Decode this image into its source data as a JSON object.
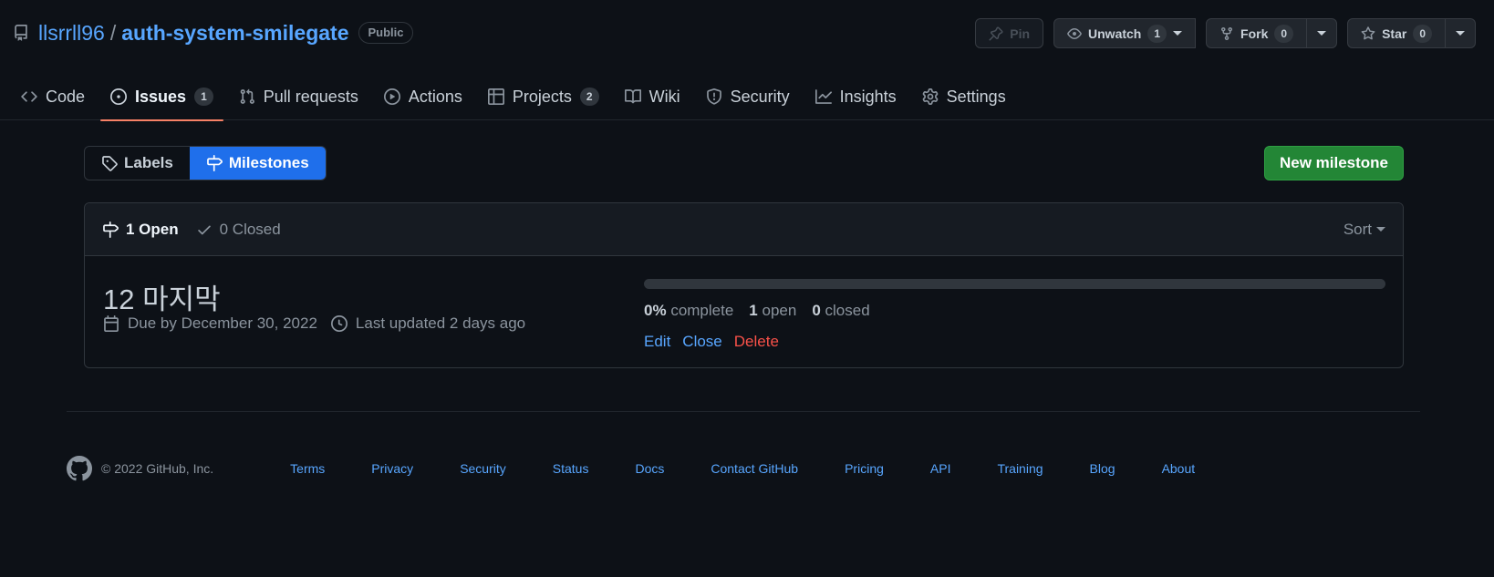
{
  "repo": {
    "owner": "llsrrll96",
    "separator": "/",
    "name": "auth-system-smilegate",
    "visibility": "Public"
  },
  "repo_actions": {
    "pin_label": "Pin",
    "unwatch_label": "Unwatch",
    "watch_count": "1",
    "fork_label": "Fork",
    "fork_count": "0",
    "star_label": "Star",
    "star_count": "0"
  },
  "nav": {
    "code": "Code",
    "issues": "Issues",
    "issues_count": "1",
    "pull_requests": "Pull requests",
    "actions": "Actions",
    "projects": "Projects",
    "projects_count": "2",
    "wiki": "Wiki",
    "security": "Security",
    "insights": "Insights",
    "settings": "Settings"
  },
  "subnav": {
    "labels": "Labels",
    "milestones": "Milestones"
  },
  "new_milestone_label": "New milestone",
  "list": {
    "open_label": "1 Open",
    "closed_label": "0 Closed",
    "sort_label": "Sort"
  },
  "milestones": [
    {
      "title": "12 마지막",
      "due": "Due by December 30, 2022",
      "updated": "Last updated 2 days ago",
      "progress_percent": 0,
      "percent_value": "0%",
      "percent_label": "complete",
      "open_count": "1",
      "open_label": "open",
      "closed_count": "0",
      "closed_label": "closed",
      "edit_label": "Edit",
      "close_label": "Close",
      "delete_label": "Delete"
    }
  ],
  "footer": {
    "copyright": "© 2022 GitHub, Inc.",
    "links": [
      "Terms",
      "Privacy",
      "Security",
      "Status",
      "Docs",
      "Contact GitHub",
      "Pricing",
      "API",
      "Training",
      "Blog",
      "About"
    ]
  },
  "colors": {
    "accent": "#58a6ff",
    "selected_tab_underline": "#f78166",
    "primary_button": "#238636",
    "danger": "#f85149",
    "background": "#0d1117"
  }
}
